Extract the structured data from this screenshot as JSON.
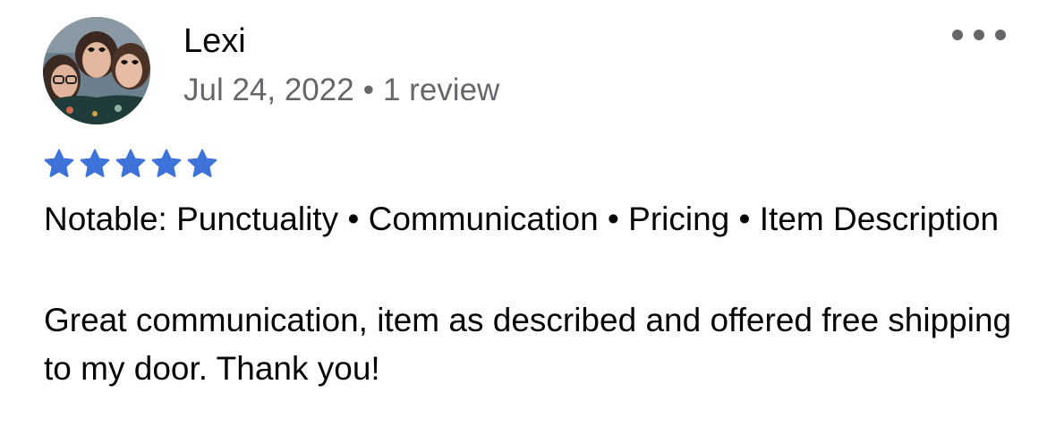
{
  "review": {
    "reviewer_name": "Lexi",
    "date": "Jul 24, 2022",
    "separator": "•",
    "review_count": "1 review",
    "rating": 5,
    "rating_max": 5,
    "star_color": "#3d72d8",
    "more_icon": "more-horizontal-icon",
    "notable": "Notable: Punctuality • Communication • Pricing • Item Description",
    "text": "Great communication, item as described and offered free shipping to my door. Thank you!"
  }
}
